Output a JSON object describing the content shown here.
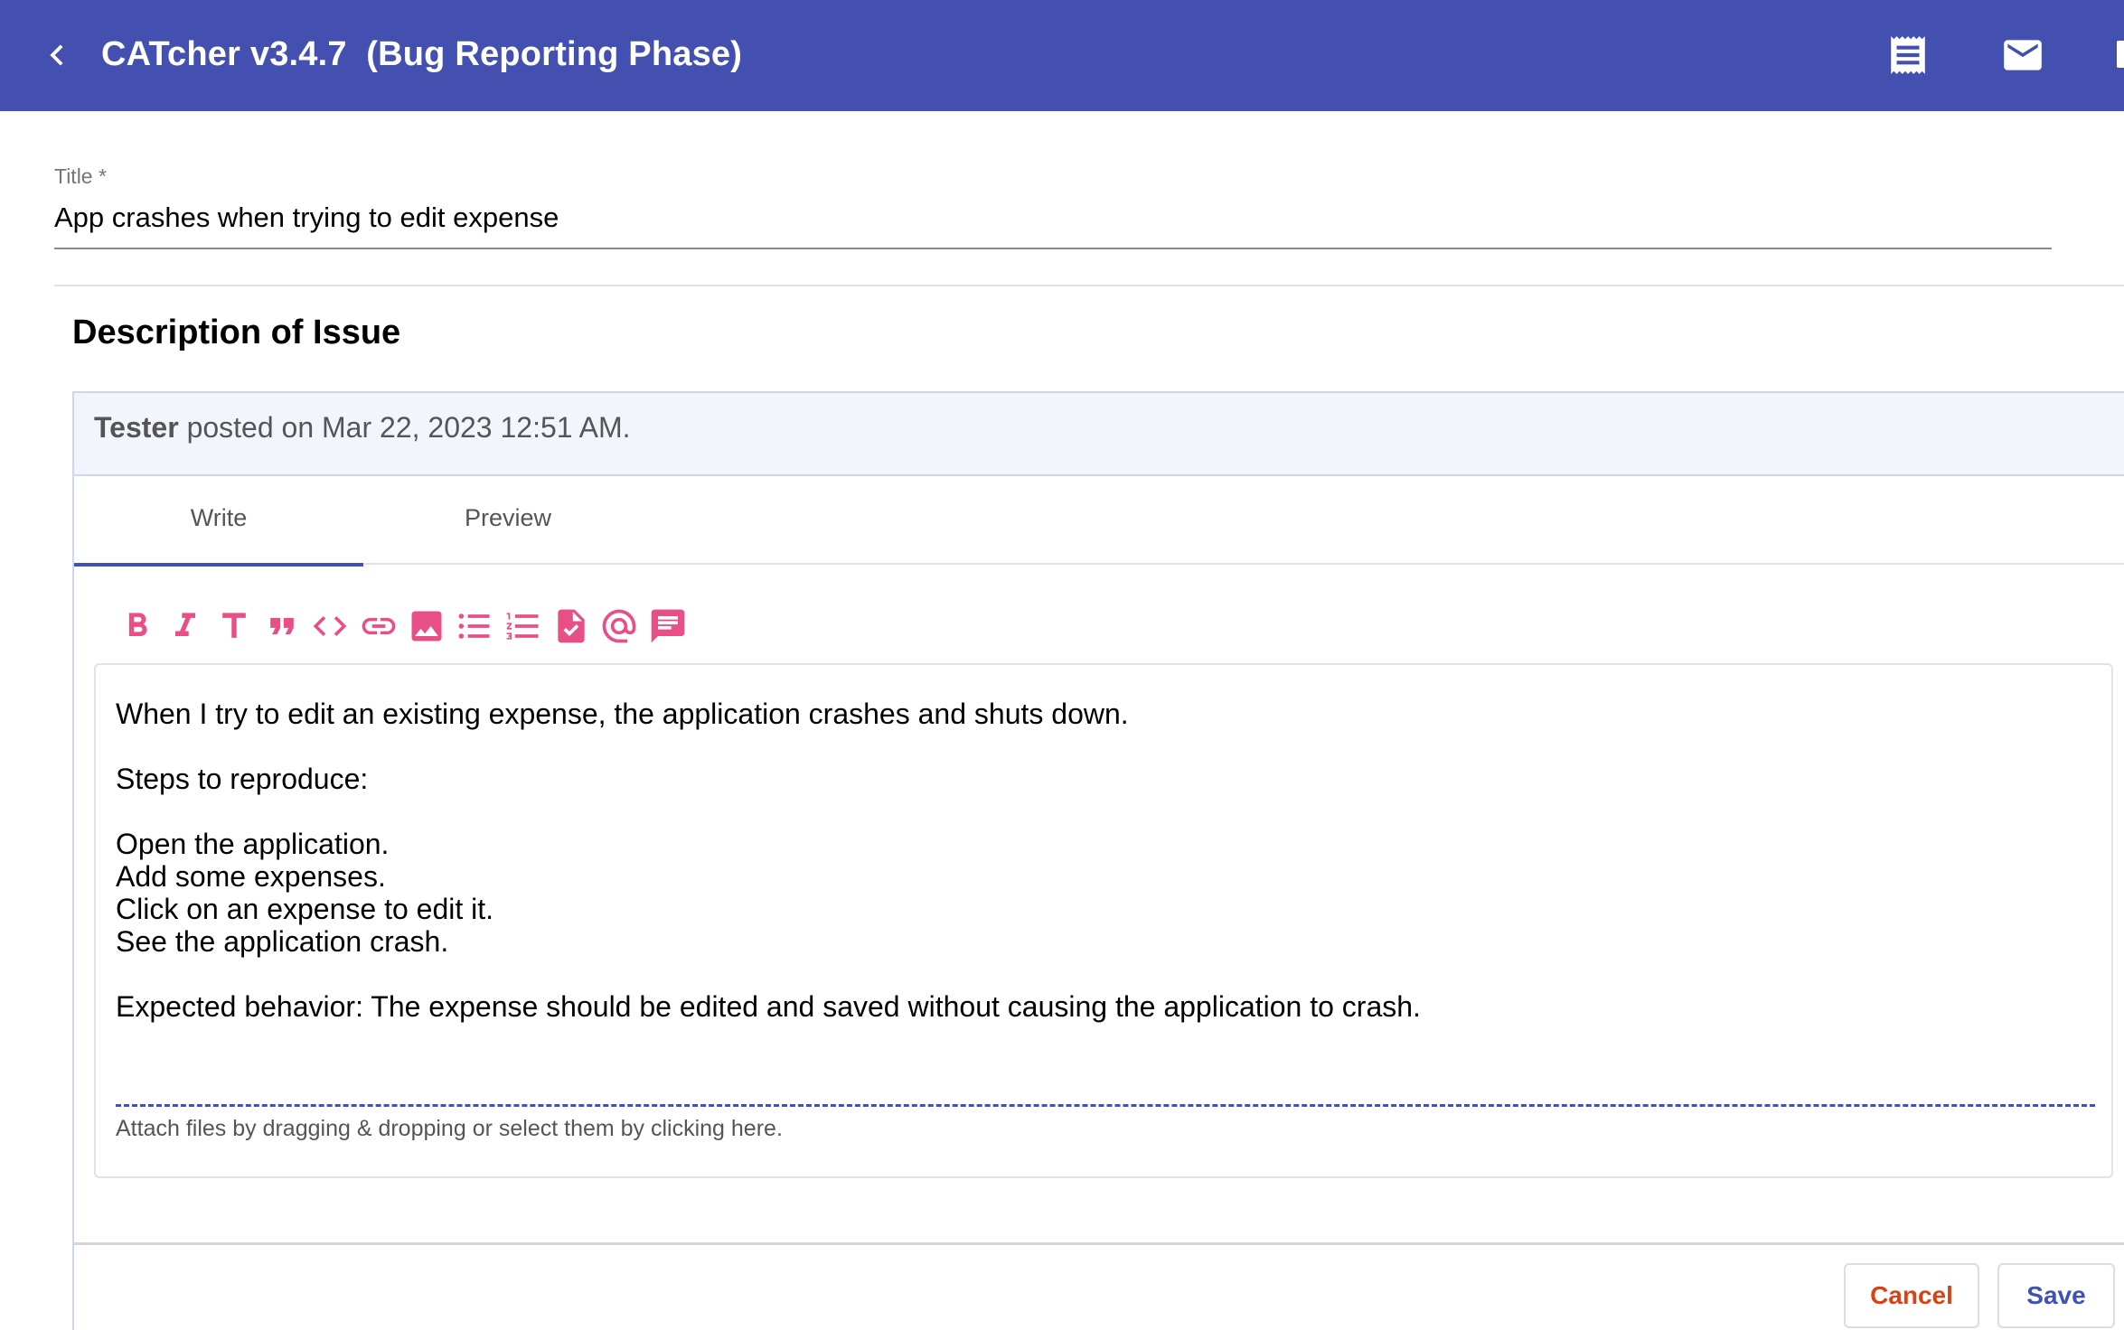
{
  "header": {
    "title": "CATcher v3.4.7  (Bug Reporting Phase)",
    "icons": [
      "back-arrow-icon",
      "activity-log-icon",
      "mail-icon"
    ]
  },
  "title_field": {
    "label": "Title *",
    "value": "App crashes when trying to edit expense"
  },
  "description": {
    "heading": "Description of Issue",
    "author": "Tester",
    "posted_text": " posted on Mar 22, 2023 12:51 AM.",
    "tabs": [
      {
        "label": "Write",
        "active": true
      },
      {
        "label": "Preview",
        "active": false
      }
    ],
    "toolbar": [
      "bold-icon",
      "italic-icon",
      "heading-icon",
      "quote-icon",
      "code-icon",
      "link-icon",
      "image-icon",
      "bulleted-list-icon",
      "numbered-list-icon",
      "task-list-icon",
      "mention-icon",
      "saved-reply-icon"
    ],
    "toolbar_color": "#e94f87",
    "body": "When I try to edit an existing expense, the application crashes and shuts down.\n\nSteps to reproduce:\n\nOpen the application.\nAdd some expenses.\nClick on an expense to edit it.\nSee the application crash.\n\nExpected behavior: The expense should be edited and saved without causing the application to crash.",
    "attach_text": "Attach files by dragging & dropping or select them by clicking here."
  },
  "actions": {
    "cancel": "Cancel",
    "save": "Save"
  },
  "colors": {
    "primary": "#4350b0",
    "cancel": "#d84315",
    "accent": "#e94f87"
  }
}
